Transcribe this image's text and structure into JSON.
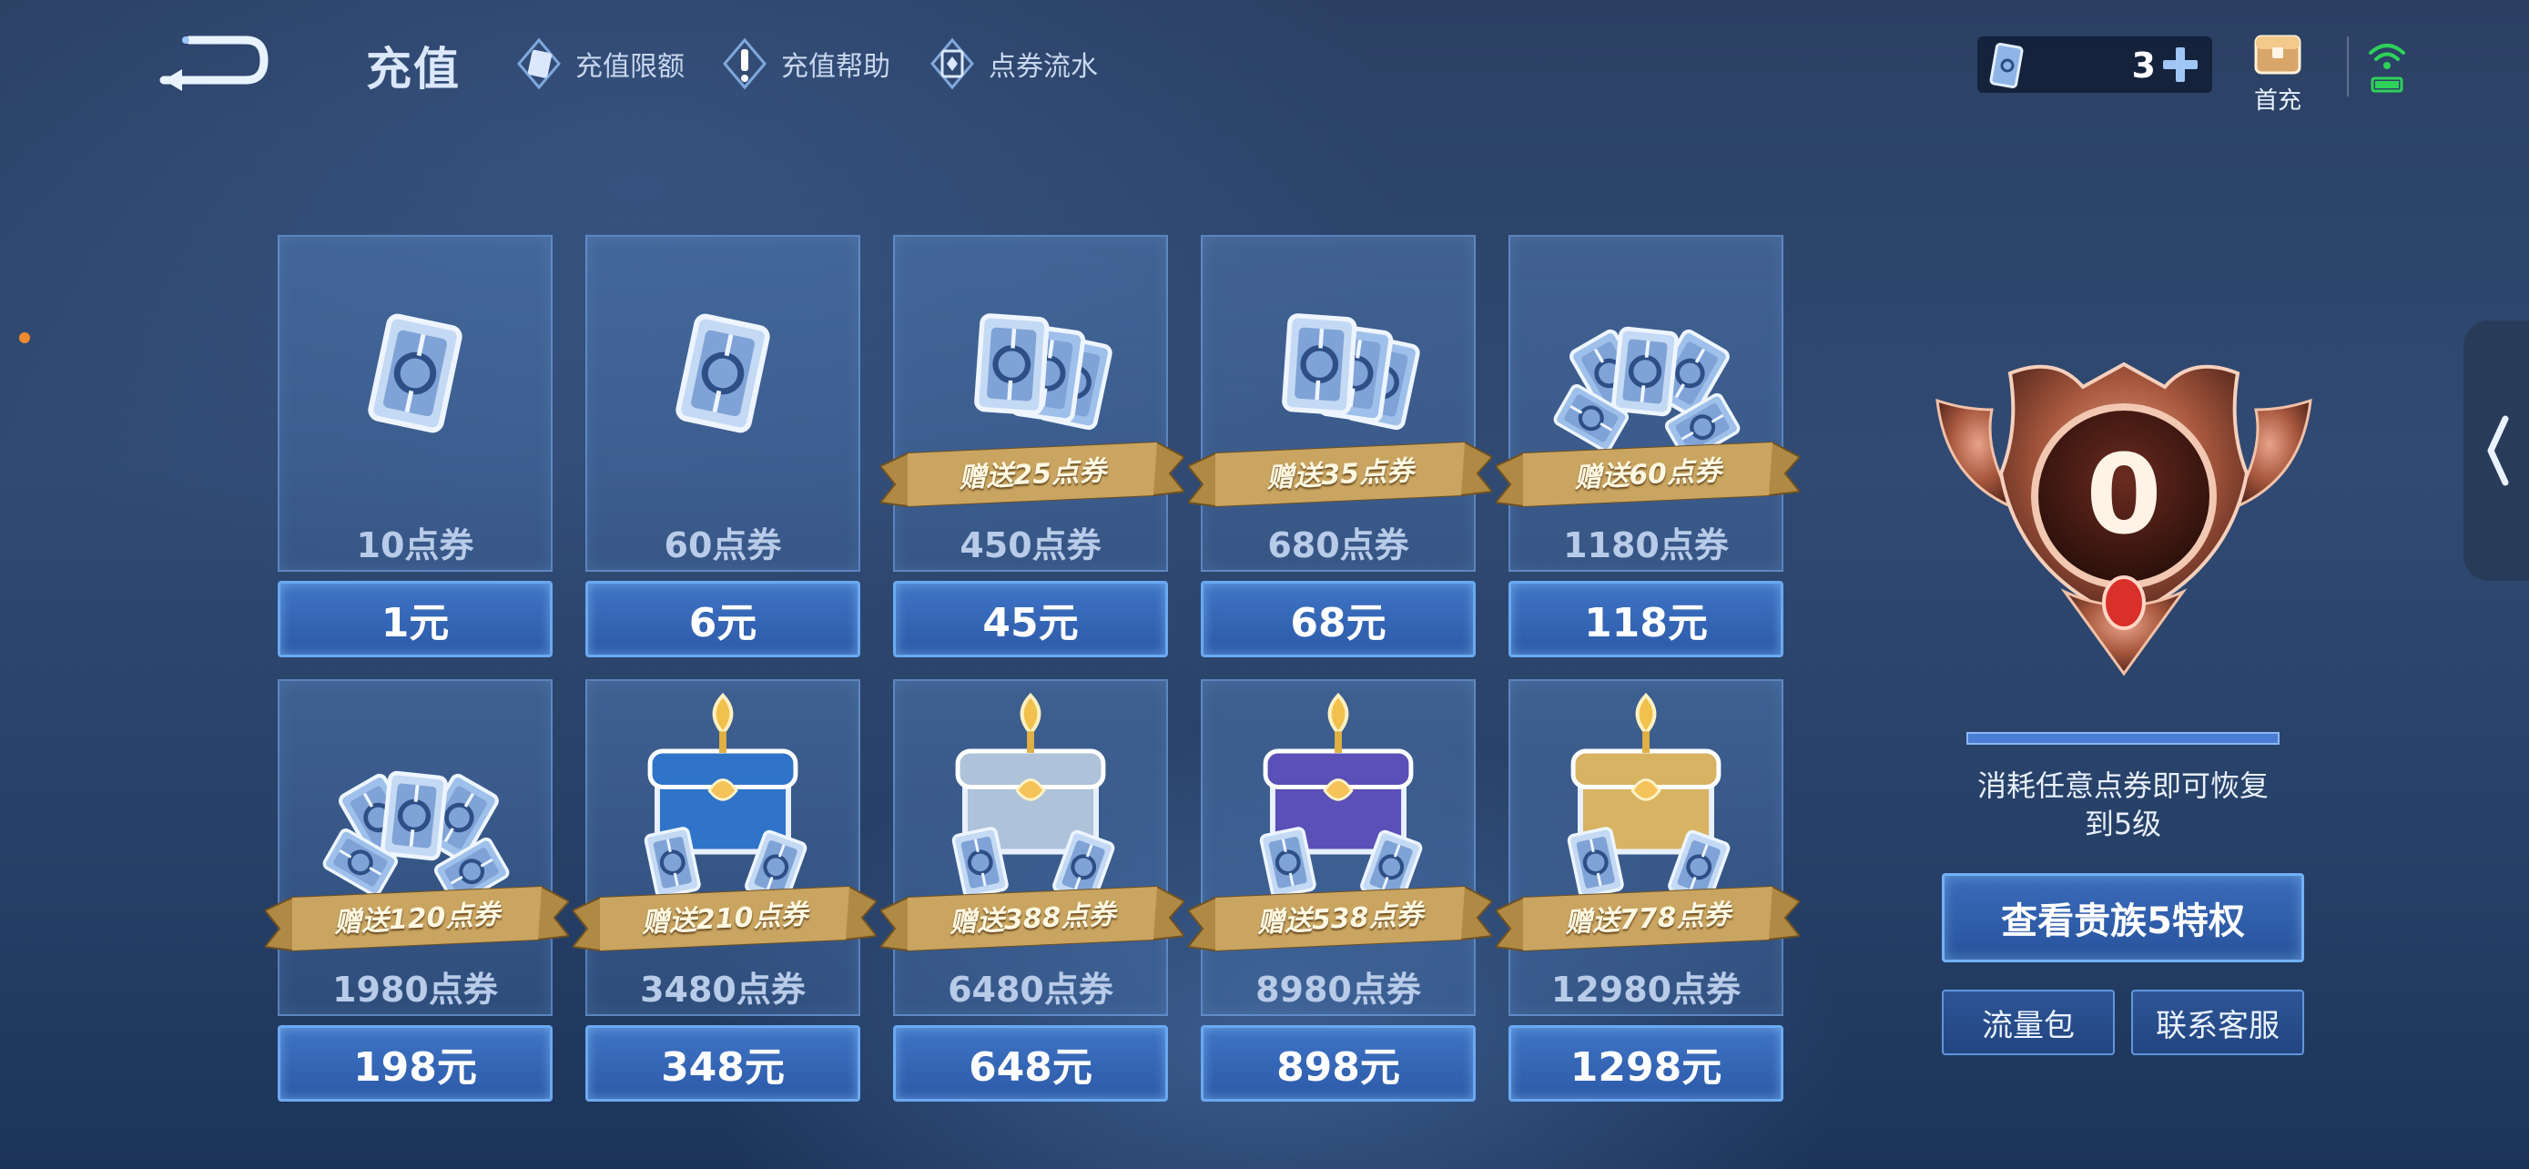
{
  "header": {
    "title": "充值",
    "links": [
      {
        "label": "充值限额",
        "icon": "card-icon"
      },
      {
        "label": "充值帮助",
        "icon": "help-icon"
      },
      {
        "label": "点券流水",
        "icon": "record-icon"
      }
    ],
    "balance": "3",
    "first_charge_label": "首充"
  },
  "products": [
    {
      "amount": "10点券",
      "price": "1元",
      "bonus": "",
      "art": "single-ticket"
    },
    {
      "amount": "60点券",
      "price": "6元",
      "bonus": "",
      "art": "single-ticket"
    },
    {
      "amount": "450点券",
      "price": "45元",
      "bonus": "赠送25点券",
      "art": "ticket-stack"
    },
    {
      "amount": "680点券",
      "price": "68元",
      "bonus": "赠送35点券",
      "art": "ticket-stack"
    },
    {
      "amount": "1180点券",
      "price": "118元",
      "bonus": "赠送60点券",
      "art": "ticket-pile"
    },
    {
      "amount": "1980点券",
      "price": "198元",
      "bonus": "赠送120点券",
      "art": "ticket-pile"
    },
    {
      "amount": "3480点券",
      "price": "348元",
      "bonus": "赠送210点券",
      "art": "chest-blue"
    },
    {
      "amount": "6480点券",
      "price": "648元",
      "bonus": "赠送388点券",
      "art": "chest-silver"
    },
    {
      "amount": "8980点券",
      "price": "898元",
      "bonus": "赠送538点券",
      "art": "chest-purple"
    },
    {
      "amount": "12980点券",
      "price": "1298元",
      "bonus": "赠送778点券",
      "art": "chest-gold"
    }
  ],
  "vip": {
    "level": "0",
    "note_line1": "消耗任意点券即可恢复",
    "note_line2": "到5级",
    "privilege_button": "查看贵族5特权",
    "data_pack_button": "流量包",
    "support_button": "联系客服"
  },
  "colors": {
    "accent": "#6aa9f2",
    "button_fill": "#2c5aa8",
    "ribbon_gold": "#b08a44",
    "badge_bronze": "#a8583e"
  }
}
